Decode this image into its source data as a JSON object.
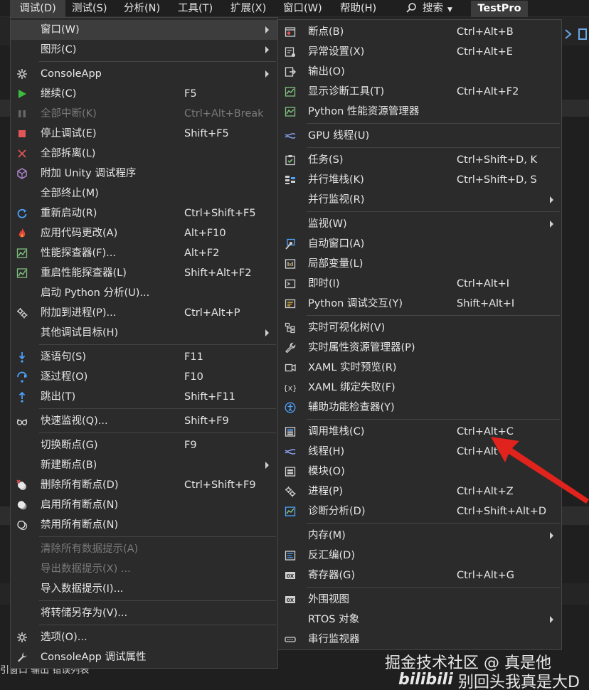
{
  "menubar": {
    "items": [
      "调试(D)",
      "测试(S)",
      "分析(N)",
      "工具(T)",
      "扩展(X)",
      "窗口(W)",
      "帮助(H)"
    ],
    "search_label": "搜索",
    "title": "TestPro"
  },
  "background": {
    "bottom_tabs": "引窗口   输出   错误列表"
  },
  "debug_menu": {
    "items": [
      {
        "label": "窗口(W)",
        "shortcut": "",
        "icon": "none",
        "submenu": true,
        "highlighted": true
      },
      {
        "label": "图形(C)",
        "shortcut": "",
        "icon": "none",
        "submenu": true
      },
      {
        "label": "ConsoleApp",
        "shortcut": "",
        "icon": "gear-icon",
        "submenu": true
      },
      {
        "label": "继续(C)",
        "shortcut": "F5",
        "icon": "play-icon"
      },
      {
        "label": "全部中断(K)",
        "shortcut": "Ctrl+Alt+Break",
        "icon": "pause-icon",
        "disabled": true
      },
      {
        "label": "停止调试(E)",
        "shortcut": "Shift+F5",
        "icon": "stop-icon"
      },
      {
        "label": "全部拆离(L)",
        "shortcut": "",
        "icon": "detach-x-icon"
      },
      {
        "label": "附加 Unity 调试程序",
        "shortcut": "",
        "icon": "unity-cube-icon"
      },
      {
        "label": "全部终止(M)",
        "shortcut": "",
        "icon": "none"
      },
      {
        "label": "重新启动(R)",
        "shortcut": "Ctrl+Shift+F5",
        "icon": "restart-icon"
      },
      {
        "label": "应用代码更改(A)",
        "shortcut": "Alt+F10",
        "icon": "hot-reload-flame-icon"
      },
      {
        "label": "性能探查器(F)...",
        "shortcut": "Alt+F2",
        "icon": "profiler-chart-icon"
      },
      {
        "label": "重启性能探查器(L)",
        "shortcut": "Shift+Alt+F2",
        "icon": "profiler-chart-icon"
      },
      {
        "label": "启动 Python 分析(U)...",
        "shortcut": "",
        "icon": "none"
      },
      {
        "label": "附加到进程(P)...",
        "shortcut": "Ctrl+Alt+P",
        "icon": "attach-gears-icon"
      },
      {
        "label": "其他调试目标(H)",
        "shortcut": "",
        "icon": "none",
        "submenu": true
      },
      {
        "label": "逐语句(S)",
        "shortcut": "F11",
        "icon": "step-into-icon"
      },
      {
        "label": "逐过程(O)",
        "shortcut": "F10",
        "icon": "step-over-icon"
      },
      {
        "label": "跳出(T)",
        "shortcut": "Shift+F11",
        "icon": "step-out-icon"
      },
      {
        "label": "快速监视(Q)...",
        "shortcut": "Shift+F9",
        "icon": "glasses-icon"
      },
      {
        "label": "切换断点(G)",
        "shortcut": "F9",
        "icon": "none"
      },
      {
        "label": "新建断点(B)",
        "shortcut": "",
        "icon": "none",
        "submenu": true
      },
      {
        "label": "删除所有断点(D)",
        "shortcut": "Ctrl+Shift+F9",
        "icon": "delete-breakpoints-icon"
      },
      {
        "label": "启用所有断点(N)",
        "shortcut": "",
        "icon": "enable-breakpoints-icon"
      },
      {
        "label": "禁用所有断点(N)",
        "shortcut": "",
        "icon": "disable-breakpoints-icon"
      },
      {
        "label": "清除所有数据提示(A)",
        "shortcut": "",
        "icon": "none",
        "disabled": true
      },
      {
        "label": "导出数据提示(X) ...",
        "shortcut": "",
        "icon": "none",
        "disabled": true
      },
      {
        "label": "导入数据提示(I)...",
        "shortcut": "",
        "icon": "none"
      },
      {
        "label": "将转储另存为(V)...",
        "shortcut": "",
        "icon": "none"
      },
      {
        "label": "选项(O)...",
        "shortcut": "",
        "icon": "gear-icon"
      },
      {
        "label": "ConsoleApp 调试属性",
        "shortcut": "",
        "icon": "wrench-icon"
      }
    ]
  },
  "window_submenu": {
    "items": [
      {
        "label": "断点(B)",
        "shortcut": "Ctrl+Alt+B",
        "icon": "breakpoints-window-icon"
      },
      {
        "label": "异常设置(X)",
        "shortcut": "Ctrl+Alt+E",
        "icon": "exception-settings-icon"
      },
      {
        "label": "输出(O)",
        "shortcut": "",
        "icon": "output-icon"
      },
      {
        "label": "显示诊断工具(T)",
        "shortcut": "Ctrl+Alt+F2",
        "icon": "diagnostic-tools-icon"
      },
      {
        "label": "Python 性能资源管理器",
        "shortcut": "",
        "icon": "performance-explorer-icon"
      },
      {
        "label": "GPU 线程(U)",
        "shortcut": "",
        "icon": "gpu-threads-icon"
      },
      {
        "label": "任务(S)",
        "shortcut": "Ctrl+Shift+D, K",
        "icon": "tasks-icon"
      },
      {
        "label": "并行堆栈(K)",
        "shortcut": "Ctrl+Shift+D, S",
        "icon": "parallel-stacks-icon"
      },
      {
        "label": "并行监视(R)",
        "shortcut": "",
        "icon": "none",
        "submenu": true
      },
      {
        "label": "监视(W)",
        "shortcut": "",
        "icon": "none",
        "submenu": true
      },
      {
        "label": "自动窗口(A)",
        "shortcut": "",
        "icon": "autos-icon"
      },
      {
        "label": "局部变量(L)",
        "shortcut": "",
        "icon": "locals-icon"
      },
      {
        "label": "即时(I)",
        "shortcut": "Ctrl+Alt+I",
        "icon": "immediate-icon"
      },
      {
        "label": "Python 调试交互(Y)",
        "shortcut": "Shift+Alt+I",
        "icon": "python-interactive-icon"
      },
      {
        "label": "实时可视化树(V)",
        "shortcut": "",
        "icon": "visual-tree-icon"
      },
      {
        "label": "实时属性资源管理器(P)",
        "shortcut": "",
        "icon": "property-explorer-icon"
      },
      {
        "label": "XAML 实时预览(R)",
        "shortcut": "",
        "icon": "xaml-preview-icon"
      },
      {
        "label": "XAML 绑定失败(F)",
        "shortcut": "",
        "icon": "xaml-binding-icon"
      },
      {
        "label": "辅助功能检查器(Y)",
        "shortcut": "",
        "icon": "accessibility-icon"
      },
      {
        "label": "调用堆栈(C)",
        "shortcut": "Ctrl+Alt+C",
        "icon": "call-stack-icon"
      },
      {
        "label": "线程(H)",
        "shortcut": "Ctrl+Alt+",
        "icon": "threads-icon"
      },
      {
        "label": "模块(O)",
        "shortcut": "",
        "icon": "modules-icon"
      },
      {
        "label": "进程(P)",
        "shortcut": "Ctrl+Alt+Z",
        "icon": "processes-icon"
      },
      {
        "label": "诊断分析(D)",
        "shortcut": "Ctrl+Shift+Alt+D",
        "icon": "diagnostic-analysis-icon"
      },
      {
        "label": "内存(M)",
        "shortcut": "",
        "icon": "none",
        "submenu": true
      },
      {
        "label": "反汇编(D)",
        "shortcut": "",
        "icon": "disassembly-icon"
      },
      {
        "label": "寄存器(G)",
        "shortcut": "Ctrl+Alt+G",
        "icon": "registers-icon"
      },
      {
        "label": "外围视图",
        "shortcut": "",
        "icon": "peripheral-icon"
      },
      {
        "label": "RTOS 对象",
        "shortcut": "",
        "icon": "none",
        "submenu": true
      },
      {
        "label": "串行监视器",
        "shortcut": "",
        "icon": "serial-monitor-icon"
      }
    ]
  },
  "watermark": {
    "line1": "掘金技术社区 @ 真是他",
    "line2": "别回头我真是大D",
    "logo": "bilibili"
  },
  "colors": {
    "menu_bg": "#2b2b2b",
    "highlight": "#3d3d3d",
    "annotation_arrow": "#e0231c",
    "play_green": "#3dbb3d",
    "stop_red": "#e05555"
  }
}
